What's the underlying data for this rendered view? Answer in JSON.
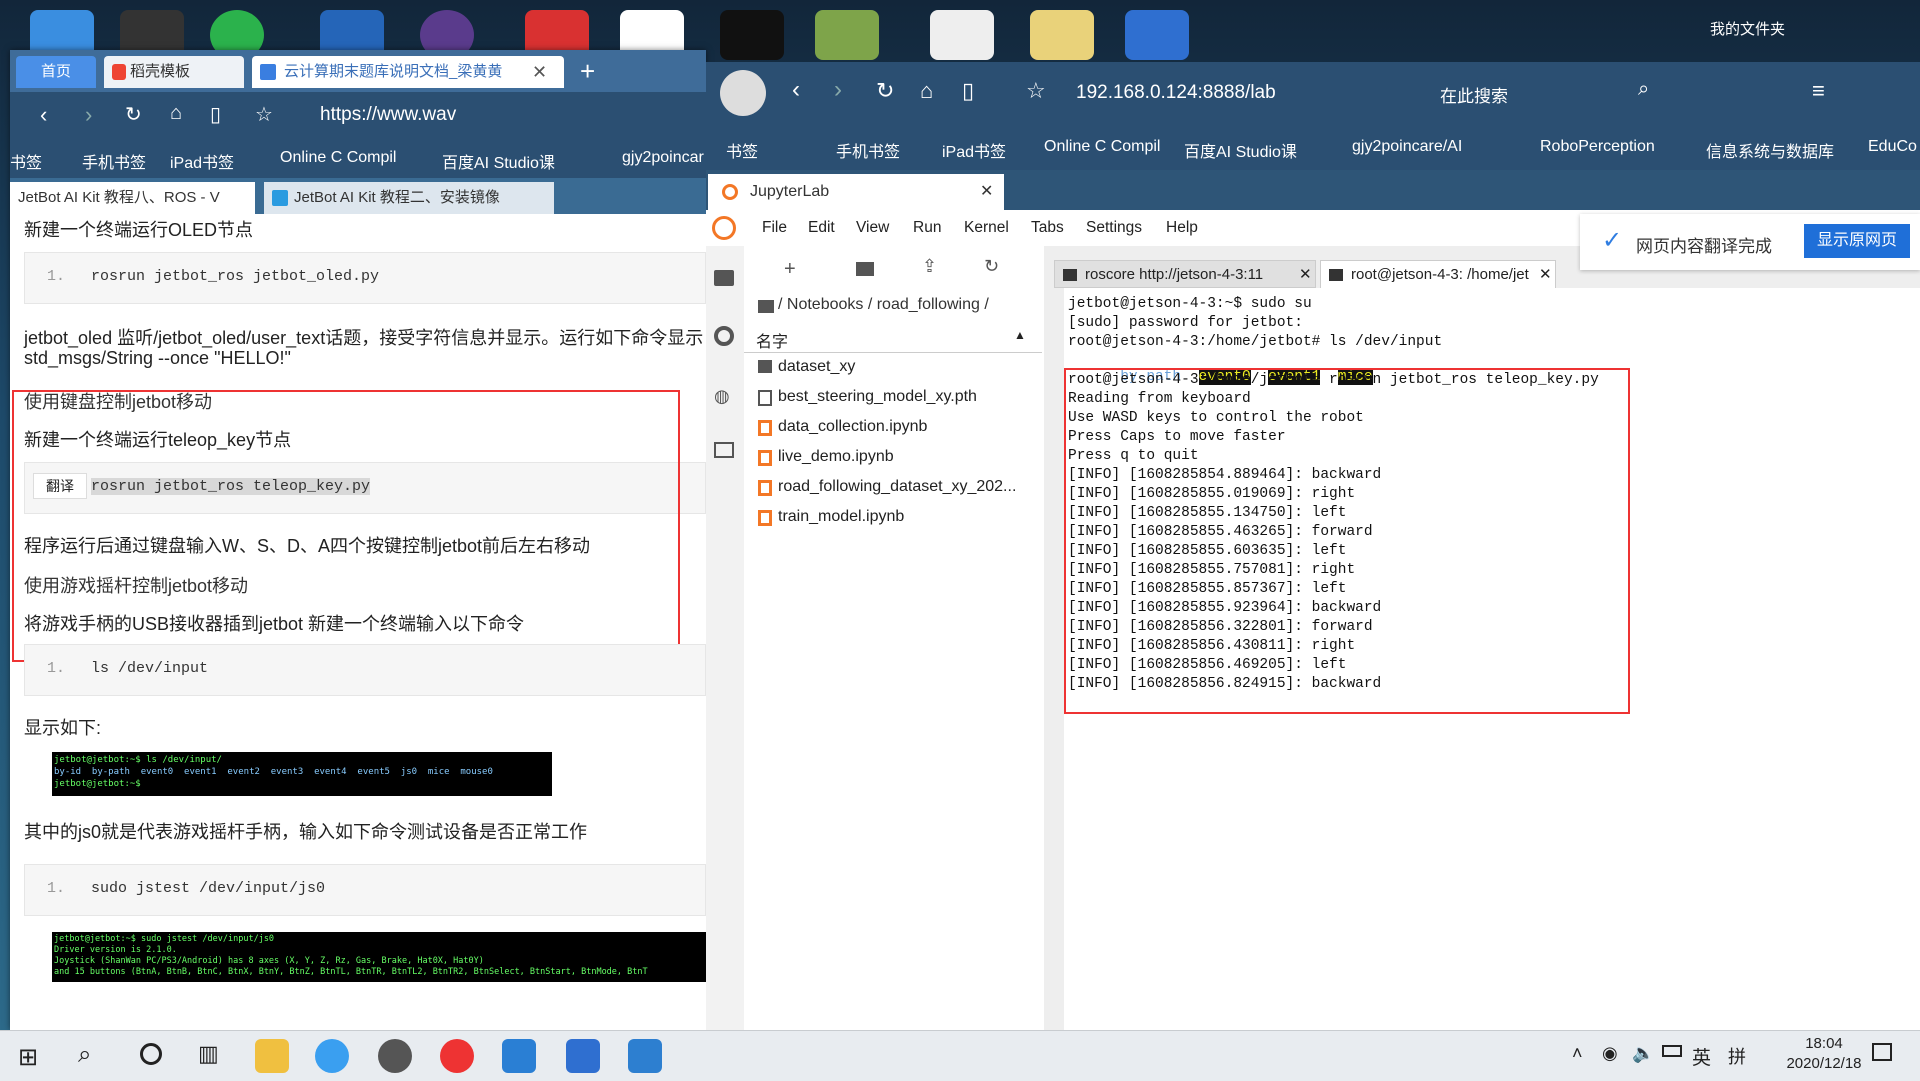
{
  "desktop": {
    "folder_label": "我的文件夹"
  },
  "left_browser": {
    "tabs": [
      "首页",
      "稻壳模板",
      "云计算期末题库说明文档_梁黄黄"
    ],
    "new_tab": "+",
    "url": "https://www.wav",
    "bookmarks": [
      "书签",
      "手机书签",
      "iPad书签",
      "Online C Compil",
      "百度AI Studio课",
      "gjy2poincar"
    ],
    "page_tabs": [
      "JetBot AI Kit 教程八、ROS - V",
      "JetBot AI Kit 教程二、安装镜像"
    ],
    "content": {
      "p1": "新建一个终端运行OLED节点",
      "code1_num": "1.",
      "code1": "rosrun jetbot_ros jetbot_oled.py",
      "p2": "jetbot_oled 监听/jetbot_oled/user_text话题，接受字符信息并显示。运行如下命令显示",
      "p3": "std_msgs/String --once \"HELLO!\"",
      "h1": "使用键盘控制jetbot移动",
      "p4": "新建一个终端运行teleop_key节点",
      "translate_btn": "翻译",
      "code2": "rosrun jetbot_ros teleop_key.py",
      "p5": "程序运行后通过键盘输入W、S、D、A四个按键控制jetbot前后左右移动",
      "h2": "使用游戏摇杆控制jetbot移动",
      "p6": "将游戏手柄的USB接收器插到jetbot 新建一个终端输入以下命令",
      "code3_num": "1.",
      "code3": "ls /dev/input",
      "p7": "显示如下:",
      "img1_lines": [
        "jetbot@jetbot:~$ ls /dev/input/",
        "by-id  by-path  event0  event1  event2  event3  event4  event5  js0  mice  mouse0",
        "jetbot@jetbot:~$ "
      ],
      "p8": "其中的js0就是代表游戏摇杆手柄，输入如下命令测试设备是否正常工作",
      "code4_num": "1.",
      "code4": "sudo jstest /dev/input/js0",
      "img2_lines": [
        "jetbot@jetbot:~$ sudo jstest /dev/input/js0",
        "Driver version is 2.1.0.",
        "Joystick (ShanWan PC/PS3/Android) has 8 axes (X, Y, Z, Rz, Gas, Brake, Hat0X, Hat0Y)",
        "and 15 buttons (BtnA, BtnB, BtnC, BtnX, BtnY, BtnZ, BtnTL, BtnTR, BtnTL2, BtnTR2, BtnSelect, BtnStart, BtnMode, BtnT"
      ]
    }
  },
  "right_browser": {
    "url": "192.168.0.124:8888/lab",
    "search_label": "在此搜索",
    "bookmarks": [
      "书签",
      "手机书签",
      "iPad书签",
      "Online C Compil",
      "百度AI Studio课",
      "gjy2poincare/AI",
      "RoboPerception",
      "信息系统与数据库",
      "EduCo"
    ],
    "tab": "JupyterLab",
    "translate_notice": "网页内容翻译完成",
    "show_original": "显示原网页",
    "menu": [
      "File",
      "Edit",
      "View",
      "Run",
      "Kernel",
      "Tabs",
      "Settings",
      "Help"
    ],
    "breadcrumb": "/ Notebooks / road_following /",
    "files_header": "名字",
    "files": [
      "dataset_xy",
      "best_steering_model_xy.pth",
      "data_collection.ipynb",
      "live_demo.ipynb",
      "road_following_dataset_xy_202...",
      "train_model.ipynb"
    ],
    "terminal_tabs": [
      "roscore http://jetson-4-3:11",
      "root@jetson-4-3: /home/jet"
    ],
    "terminal_lines": [
      "jetbot@jetson-4-3:~$ sudo su",
      "[sudo] password for jetbot:",
      "root@jetson-4-3:/home/jetbot# ls /dev/input",
      "root@jetson-4-3:/home/jetbot# rosrun jetbot_ros teleop_key.py",
      "Reading from keyboard",
      "Use WASD keys to control the robot",
      "Press Caps to move faster",
      "Press q to quit",
      "[INFO] [1608285854.889464]: backward",
      "[INFO] [1608285855.019069]: right",
      "[INFO] [1608285855.134750]: left",
      "[INFO] [1608285855.463265]: forward",
      "[INFO] [1608285855.603635]: left",
      "[INFO] [1608285855.757081]: right",
      "[INFO] [1608285855.857367]: left",
      "[INFO] [1608285855.923964]: backward",
      "[INFO] [1608285856.322801]: forward",
      "[INFO] [1608285856.430811]: right",
      "[INFO] [1608285856.469205]: left",
      "[INFO] [1608285856.824915]: backward"
    ],
    "ls_output": [
      "by-path",
      "event0",
      "event1",
      "mice"
    ]
  },
  "taskbar": {
    "ime": "英",
    "ime2": "拼",
    "time": "18:04",
    "date": "2020/12/18"
  }
}
